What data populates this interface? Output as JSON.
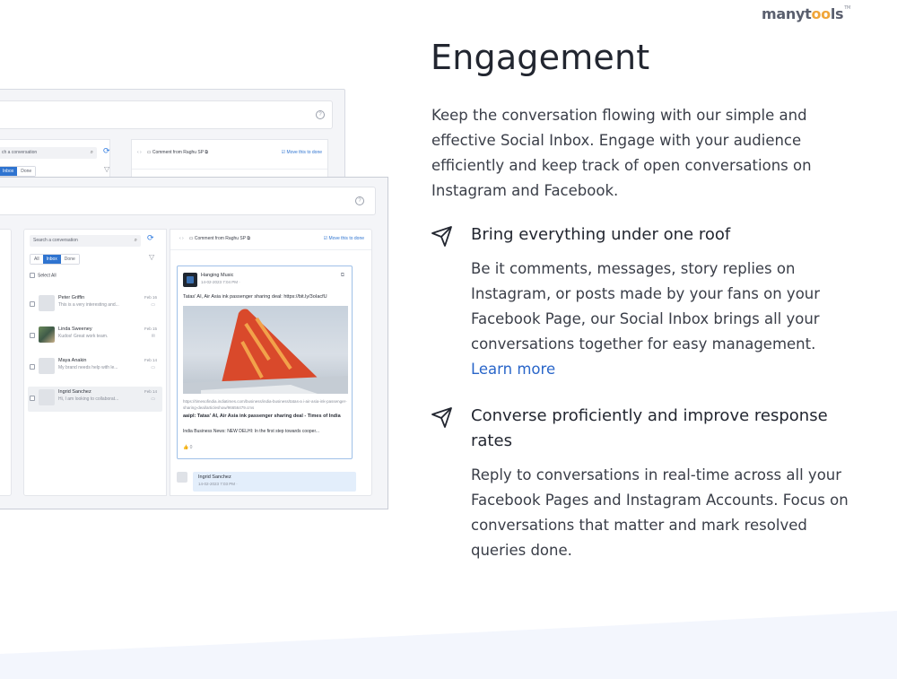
{
  "logo": {
    "text_a": "manyt",
    "text_oo": "oo",
    "text_b": "ls",
    "tm": "TM"
  },
  "heading": "Engagement",
  "intro": "Keep the conversation flowing with our simple and effective Social Inbox. Engage with your audience efficiently and keep track of open conversations on Instagram and Facebook.",
  "features": [
    {
      "icon": "paper-plane-icon",
      "title": "Bring everything under one roof",
      "body": "Be it comments, messages, story replies on Instagram, or posts made by your fans on your Facebook Page, our Social Inbox brings all your conversations together for easy management.",
      "link": "Learn more"
    },
    {
      "icon": "paper-plane-icon",
      "title": "Converse proficiently and improve response rates",
      "body": "Reply to conversations in real-time across all your Facebook Pages and Instagram Accounts. Focus on conversations that matter and mark resolved queries done."
    }
  ],
  "mock": {
    "back": {
      "search_placeholder": "ch a conversation",
      "tab_inbox": "Inbox",
      "tab_done": "Done",
      "comment_from": "Comment from Raghu SP",
      "move_done": "Move this to done"
    },
    "front": {
      "search_placeholder": "Search a conversation",
      "tabs": [
        "All",
        "Inbox",
        "Done"
      ],
      "select_all": "Select All",
      "conversations": [
        {
          "name": "Peter Griffin",
          "msg": "This is a very interesting and...",
          "date": "Feb 16"
        },
        {
          "name": "Linda Sweeney",
          "msg": "Kudos! Great work team.",
          "date": "Feb 15"
        },
        {
          "name": "Maya Anakin",
          "msg": "My brand needs help with le...",
          "date": "Feb 14"
        },
        {
          "name": "Ingrid Sanchez",
          "msg": "Hi, I am looking to collaborat...",
          "date": "Feb 14"
        }
      ],
      "comment_from": "Comment from Raghu SP",
      "move_done": "Move this to done",
      "post": {
        "author": "Hanging Music",
        "date": "14-02-2023 7:04 PM ·",
        "text": "Tatas' AI, Air Asia ink passenger sharing deal: https://bit.ly/3oIacfU",
        "url": "https://timesofindia.indiatimes.com/business/india-business/tatas-a i-air-asia-ink-passenger-sharing-deal/articleshow/96656479.cms",
        "link_title": "aaipl: Tatas' AI, Air Asia ink passenger sharing deal - Times of India",
        "link_desc": "India Business News: NEW DELHI: In the first step towards cooper...",
        "likes": "0"
      },
      "reply": {
        "name": "Ingrid Sanchez",
        "date": "14-02-2023 7:03 PM ·"
      }
    }
  },
  "colors": {
    "accent": "#2f74d0",
    "link": "#2a66c9",
    "logo_oo": "#f0a53a",
    "plane_tail": "#d9492b"
  }
}
